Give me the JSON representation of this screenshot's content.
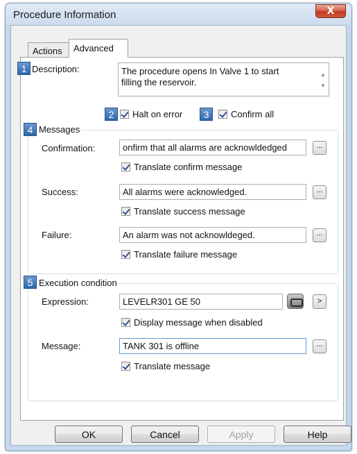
{
  "window": {
    "title": "Procedure Information",
    "close_label": "X"
  },
  "tabs": [
    {
      "label": "Actions",
      "selected": false
    },
    {
      "label": "Advanced",
      "selected": true
    }
  ],
  "badges": {
    "b1": "1",
    "b2": "2",
    "b3": "3",
    "b4": "4",
    "b5": "5"
  },
  "description": {
    "label": "Description:",
    "line1": "The procedure opens In Valve 1 to start",
    "line2": "filling the reservoir."
  },
  "halt_on_error": {
    "label": "Halt on error",
    "checked": true
  },
  "confirm_all": {
    "label": "Confirm all",
    "checked": true
  },
  "messages": {
    "group_title": "Messages",
    "confirmation": {
      "label": "Confirmation:",
      "value": "onfirm that all alarms are acknowldedged",
      "translate_label": "Translate confirm message",
      "translate_checked": true
    },
    "success": {
      "label": "Success:",
      "value": "All alarms were acknowledged.",
      "translate_label": "Translate success message",
      "translate_checked": true
    },
    "failure": {
      "label": "Failure:",
      "value": "An alarm was not acknowldeged.",
      "translate_label": "Translate failure message",
      "translate_checked": true
    },
    "browse_label": "..."
  },
  "execution": {
    "group_title": "Execution condition",
    "expression_label": "Expression:",
    "expression_value": "LEVELR301 GE 50",
    "expand_label": ">",
    "display_disabled_label": "Display message when disabled",
    "display_disabled_checked": true,
    "message_label": "Message:",
    "message_value": "TANK 301 is offline",
    "translate_label": "Translate message",
    "translate_checked": true
  },
  "buttons": {
    "ok": "OK",
    "cancel": "Cancel",
    "apply": "Apply",
    "help": "Help"
  }
}
